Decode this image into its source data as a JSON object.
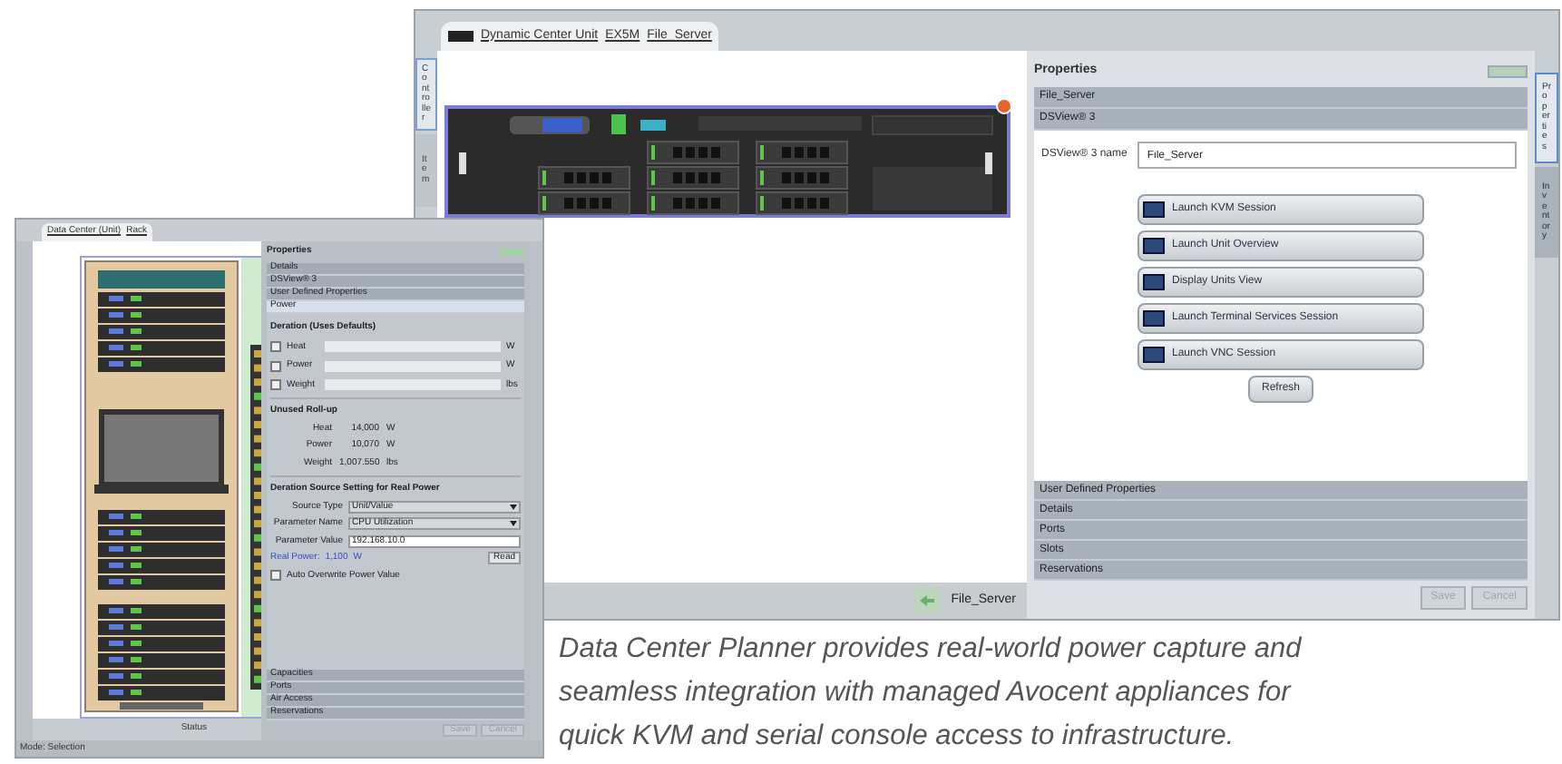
{
  "main_window": {
    "breadcrumbs": [
      "Dynamic Center Unit",
      "EX5M",
      "File_Server"
    ],
    "left_tabs": [
      {
        "label": "Controller",
        "selected": true
      },
      {
        "label": "Item",
        "selected": false
      }
    ],
    "properties": {
      "title": "Properties",
      "sections_top": [
        "File_Server",
        "DSView® 3"
      ],
      "name_label": "DSView® 3 name",
      "name_value": "File_Server",
      "actions": [
        "Launch KVM Session",
        "Launch Unit Overview",
        "Display Units View",
        "Launch Terminal Services Session",
        "Launch VNC Session"
      ],
      "refresh": "Refresh",
      "sections_bottom": [
        "User Defined Properties",
        "Details",
        "Ports",
        "Slots",
        "Reservations"
      ],
      "buttons": [
        {
          "label": "Save",
          "disabled": true
        },
        {
          "label": "Cancel",
          "disabled": true
        }
      ]
    },
    "side_tabs": [
      {
        "label": "Properties",
        "selected": true
      },
      {
        "label": "Inventory",
        "selected": false
      }
    ],
    "status_label": "File_Server"
  },
  "small_window": {
    "breadcrumbs": [
      "Data Center (Unit)",
      "Rack"
    ],
    "properties": {
      "title": "Properties",
      "sections_top": [
        {
          "label": "Details",
          "selected": false
        },
        {
          "label": "DSView® 3",
          "selected": false
        },
        {
          "label": "User Defined Properties",
          "selected": false
        },
        {
          "label": "Power",
          "selected": true
        }
      ],
      "deration_title": "Deration (Uses Defaults)",
      "deration_rows": [
        {
          "label": "Heat",
          "unit": "W",
          "checked": false
        },
        {
          "label": "Power",
          "unit": "W",
          "checked": false
        },
        {
          "label": "Weight",
          "unit": "lbs",
          "checked": false
        }
      ],
      "rollup_title": "Unused Roll-up",
      "rollup_rows": [
        {
          "label": "Heat",
          "value": "14,000",
          "unit": "W"
        },
        {
          "label": "Power",
          "value": "10,070",
          "unit": "W"
        },
        {
          "label": "Weight",
          "value": "1,007.550",
          "unit": "lbs"
        }
      ],
      "source_title": "Deration Source Setting for Real Power",
      "source_rows": [
        {
          "label": "Source Type",
          "kind": "select",
          "value": "Unit/Value"
        },
        {
          "label": "Parameter Name",
          "kind": "select",
          "value": "CPU Utilization"
        },
        {
          "label": "Parameter Value",
          "kind": "input",
          "value": "192.168.10.0"
        }
      ],
      "real_power": {
        "label": "Real Power:",
        "value": "1,100",
        "unit": "W"
      },
      "read": "Read",
      "auto": {
        "label": "Auto Overwrite Power Value",
        "checked": false
      },
      "sections_bottom": [
        "Capacities",
        "Ports",
        "Air Access",
        "Reservations"
      ],
      "buttons": [
        {
          "label": "Save",
          "disabled": true
        },
        {
          "label": "Cancel",
          "disabled": true
        }
      ]
    },
    "canvas_label": "Status",
    "status": "Mode: Selection"
  },
  "caption": [
    "Data Center Planner provides real-world power capture and",
    "seamless integration with managed Avocent appliances for",
    "quick KVM and serial console access to infrastructure."
  ]
}
